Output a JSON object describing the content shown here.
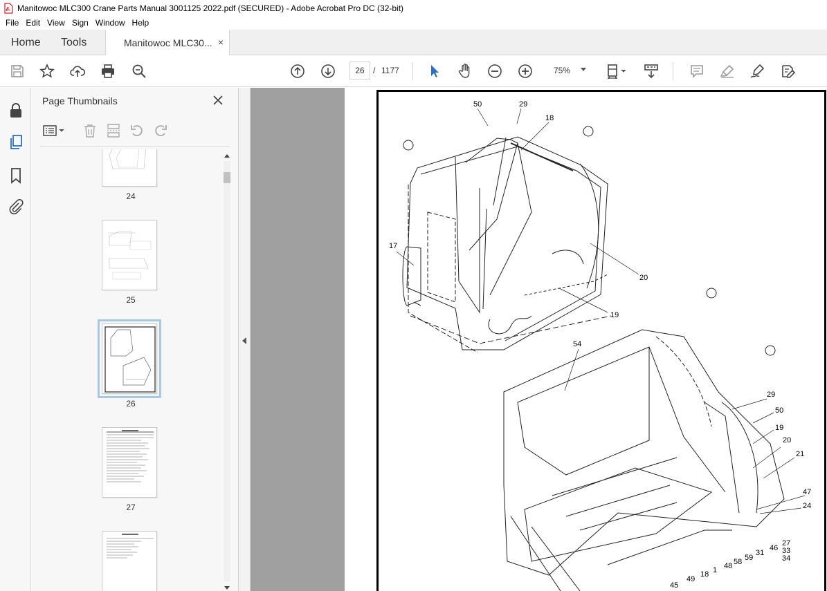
{
  "window": {
    "title": "Manitowoc MLC300 Crane Parts Manual 3001125 2022.pdf (SECURED) - Adobe Acrobat Pro DC (32-bit)"
  },
  "menu": [
    "File",
    "Edit",
    "View",
    "Sign",
    "Window",
    "Help"
  ],
  "tabs": {
    "home": "Home",
    "tools": "Tools",
    "document": "Manitowoc MLC30...",
    "close": "×"
  },
  "toolbar": {
    "current_page": "26",
    "page_separator": "/",
    "total_pages": "1177",
    "zoom": "75%"
  },
  "thumbnails": {
    "title": "Page Thumbnails",
    "pages": [
      {
        "label": "24"
      },
      {
        "label": "25"
      },
      {
        "label": "26",
        "selected": true
      },
      {
        "label": "27"
      }
    ]
  },
  "drawing": {
    "callouts": [
      "50",
      "29",
      "18",
      "17",
      "20",
      "19",
      "54",
      "29",
      "50",
      "19",
      "20",
      "21",
      "47",
      "24",
      "27",
      "33",
      "34",
      "46",
      "31",
      "59",
      "58",
      "48",
      "1",
      "18",
      "49",
      "45"
    ]
  },
  "colors": {
    "accent": "#2b6fc7",
    "selected_thumb": "#a9c8e3",
    "doc_background": "#a0a0a0",
    "pdf_red": "#d8232a"
  }
}
